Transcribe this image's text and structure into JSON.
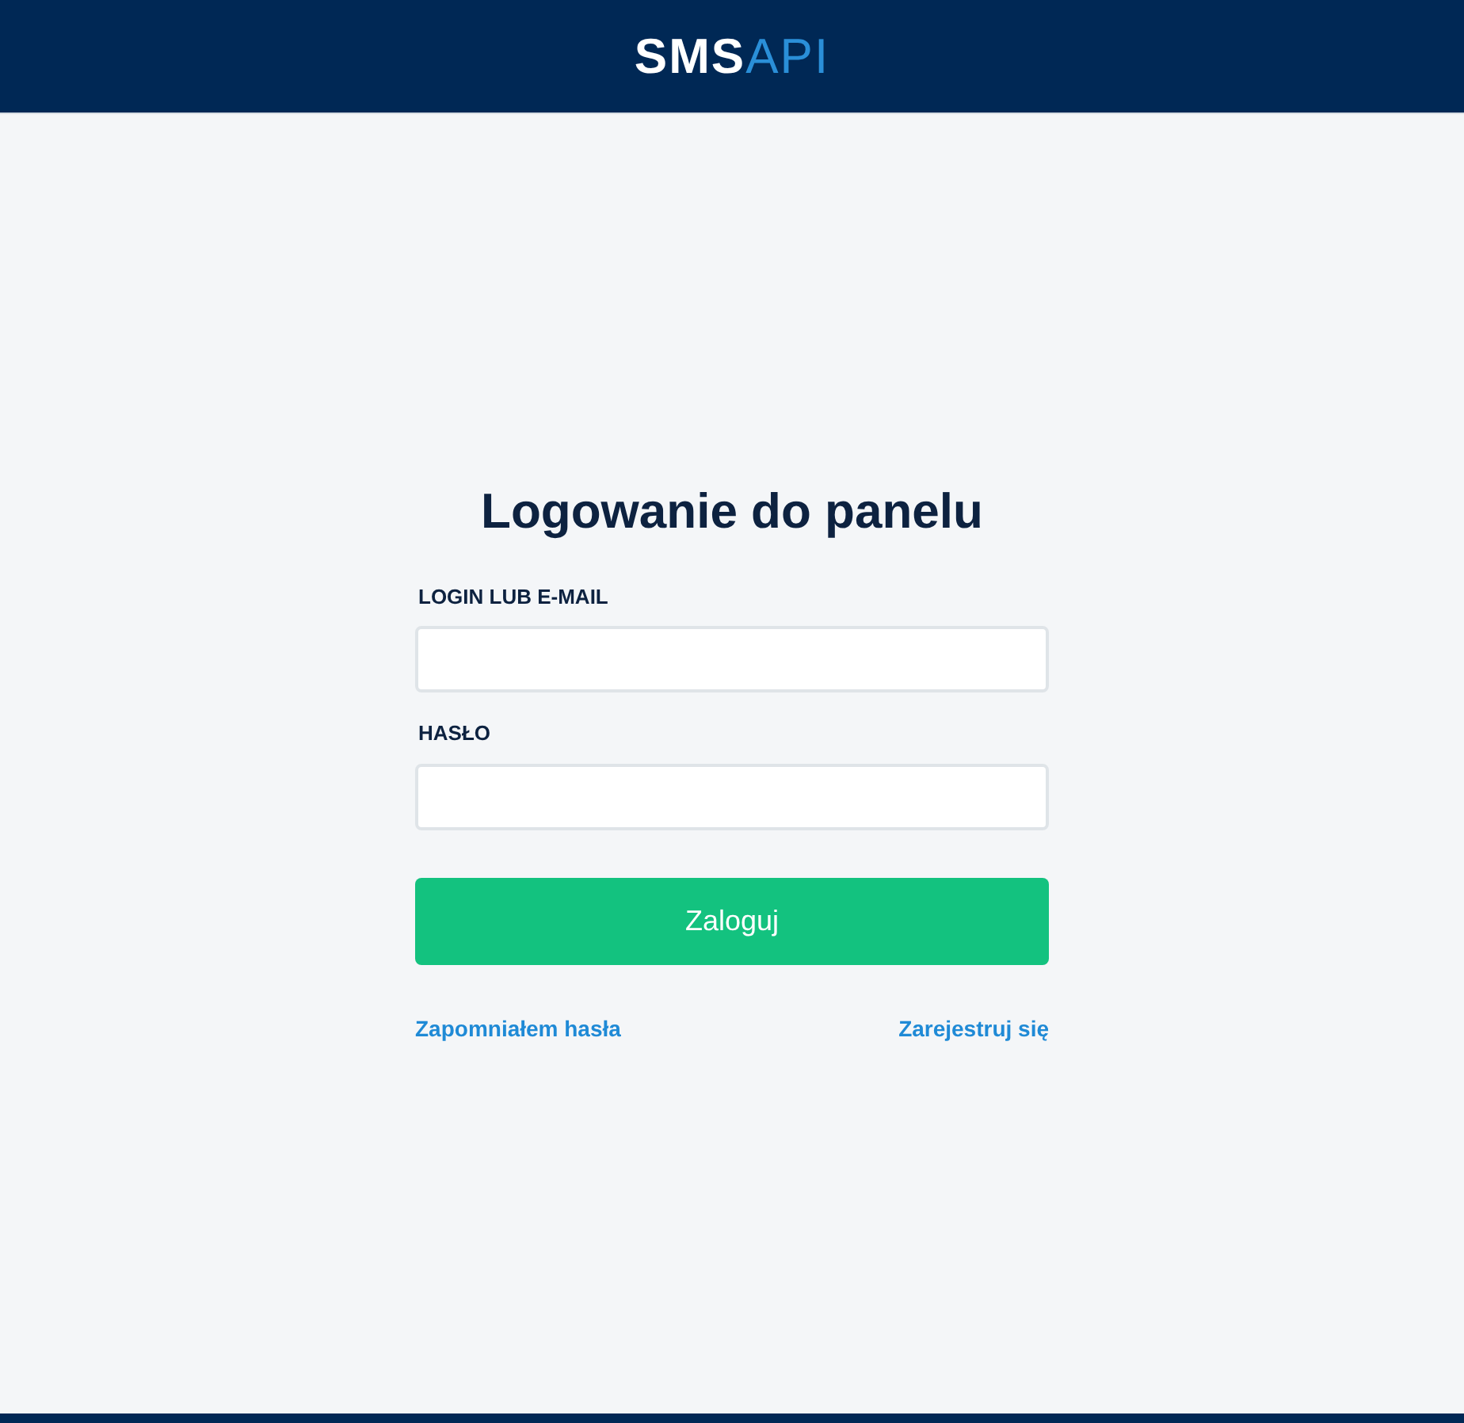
{
  "header": {
    "logo": {
      "primary": "SMS",
      "accent": "API"
    }
  },
  "login": {
    "title": "Logowanie do panelu",
    "fields": [
      {
        "label": "LOGIN LUB E-MAIL"
      },
      {
        "label": "HASŁO"
      }
    ],
    "submit": "Zaloguj",
    "links": [
      {
        "label": "Zapomniałem hasła"
      },
      {
        "label": "Zarejestruj się"
      }
    ]
  }
}
